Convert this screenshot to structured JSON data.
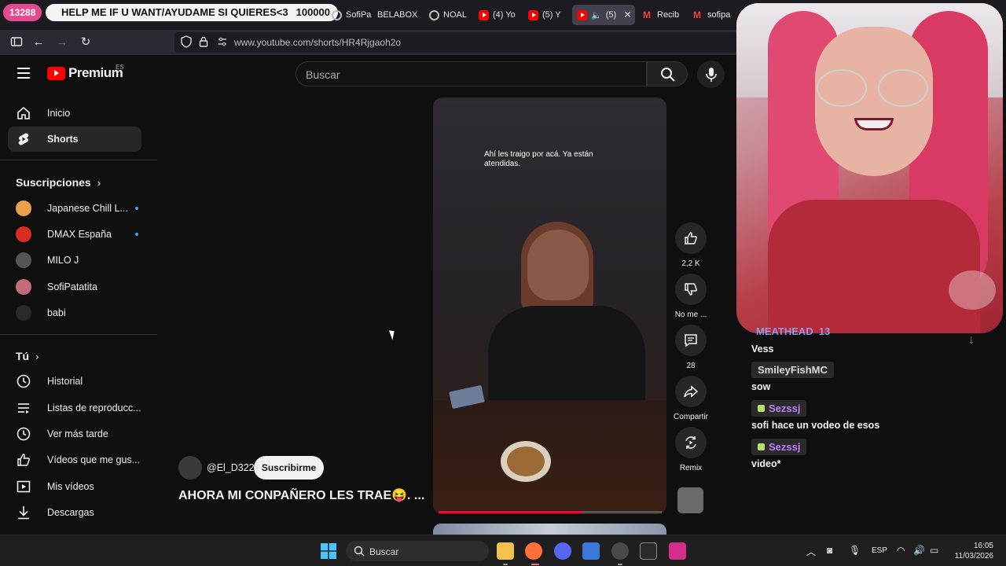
{
  "browser": {
    "overlay_count": "13288",
    "overlay_banner": "HELP ME IF U WANT/AYUDAME SI QUIERES<3",
    "overlay_banner_count": "100000",
    "tabs": [
      {
        "label": "SofiPa"
      },
      {
        "label": "BELABOX"
      },
      {
        "label": "NOAL"
      },
      {
        "label": "(4) Yo"
      },
      {
        "label": "(5) Y"
      },
      {
        "label": "(5)"
      },
      {
        "label": "Recib"
      },
      {
        "label": "sofipa"
      }
    ],
    "url": "www.youtube.com/shorts/HR4Rjgaoh2o"
  },
  "youtube": {
    "logo_text": "Premium",
    "logo_region": "ES",
    "search_placeholder": "Buscar",
    "sidebar": {
      "main": [
        {
          "label": "Inicio"
        },
        {
          "label": "Shorts"
        }
      ],
      "subs_heading": "Suscripciones",
      "subscriptions": [
        {
          "label": "Japanese Chill L...",
          "color": "#e8a04a"
        },
        {
          "label": "DMAX España",
          "color": "#d62d20"
        },
        {
          "label": "MILO J",
          "color": "#555555"
        },
        {
          "label": "SofiPatatita",
          "color": "#c06c7a"
        },
        {
          "label": "babi",
          "color": "#2a2a2a"
        }
      ],
      "you_heading": "Tú",
      "you": [
        {
          "label": "Historial"
        },
        {
          "label": "Listas de reproducc..."
        },
        {
          "label": "Ver más tarde"
        },
        {
          "label": "Vídeos que me gus..."
        },
        {
          "label": "Mis vídeos"
        },
        {
          "label": "Descargas"
        }
      ]
    },
    "short": {
      "caption": "Ahí les traigo por acá. Ya están atendidas.",
      "channel": "@El_D322",
      "subscribe_label": "Suscribirme",
      "title": "AHORA MI CONPAÑERO LES TRAE😝.  ...",
      "progress": 0.64,
      "actions": [
        {
          "label": "2,2 K",
          "icon": "thumbs-up-icon"
        },
        {
          "label": "No me ...",
          "icon": "thumbs-down-icon"
        },
        {
          "label": "28",
          "icon": "comment-icon"
        },
        {
          "label": "Compartir",
          "icon": "share-icon"
        },
        {
          "label": "Remix",
          "icon": "remix-icon"
        }
      ]
    }
  },
  "chat": {
    "partial_user": "MEATHEAD_13",
    "messages": [
      {
        "user": "",
        "text": "Vess"
      },
      {
        "user": "SmileyFishMC",
        "text": "sow"
      },
      {
        "user": "Sezssj",
        "text": "sofi hace un vodeo de esos"
      },
      {
        "user": "Sezssj",
        "text": "video*"
      }
    ]
  },
  "taskbar": {
    "search_label": "Buscar",
    "lang": "ESP",
    "time": "16:05",
    "date": "11/03/2026"
  }
}
